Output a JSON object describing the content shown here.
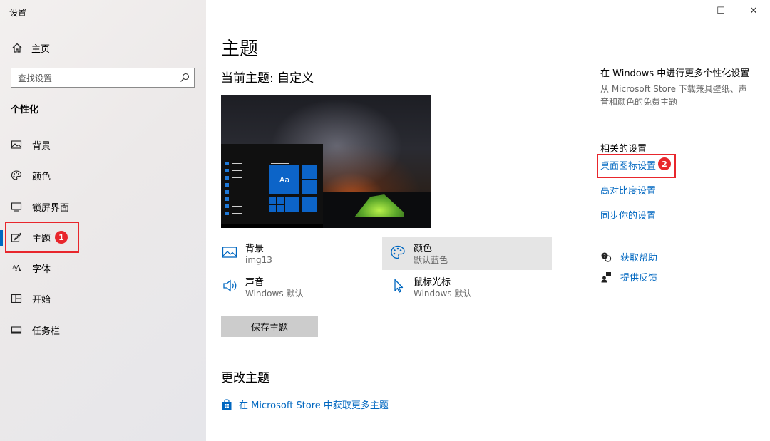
{
  "window": {
    "title": "设置",
    "controls": {
      "minimize": "—",
      "maximize": "☐",
      "close": "✕"
    }
  },
  "sidebar": {
    "home_label": "主页",
    "search_placeholder": "查找设置",
    "section_title": "个性化",
    "items": [
      {
        "label": "背景",
        "icon": "picture-icon"
      },
      {
        "label": "颜色",
        "icon": "palette-icon"
      },
      {
        "label": "锁屏界面",
        "icon": "monitor-icon"
      },
      {
        "label": "主题",
        "icon": "theme-brush-icon",
        "selected": true
      },
      {
        "label": "字体",
        "icon": "font-icon"
      },
      {
        "label": "开始",
        "icon": "start-tiles-icon"
      },
      {
        "label": "任务栏",
        "icon": "taskbar-icon"
      }
    ],
    "badge_1": "1"
  },
  "main": {
    "page_title": "主题",
    "current_theme": "当前主题: 自定义",
    "preview_tile_text": "Aa",
    "options": {
      "background": {
        "title": "背景",
        "value": "img13"
      },
      "color": {
        "title": "颜色",
        "value": "默认蓝色"
      },
      "sound": {
        "title": "声音",
        "value": "Windows 默认"
      },
      "cursor": {
        "title": "鼠标光标",
        "value": "Windows 默认"
      }
    },
    "save_button": "保存主题",
    "change_theme_title": "更改主题",
    "store_link": "在 Microsoft Store 中获取更多主题"
  },
  "right": {
    "more_title": "在 Windows 中进行更多个性化设置",
    "more_desc": "从 Microsoft Store 下载兼具壁纸、声音和颜色的免费主题",
    "related_title": "相关的设置",
    "links": {
      "desktop_icons": "桌面图标设置",
      "high_contrast": "高对比度设置",
      "sync": "同步你的设置"
    },
    "badge_2": "2",
    "get_help": "获取帮助",
    "feedback": "提供反馈"
  },
  "colors": {
    "accent": "#0067c0",
    "annotation_red": "#e8262c",
    "sidebar_bg": "#eeebea"
  }
}
